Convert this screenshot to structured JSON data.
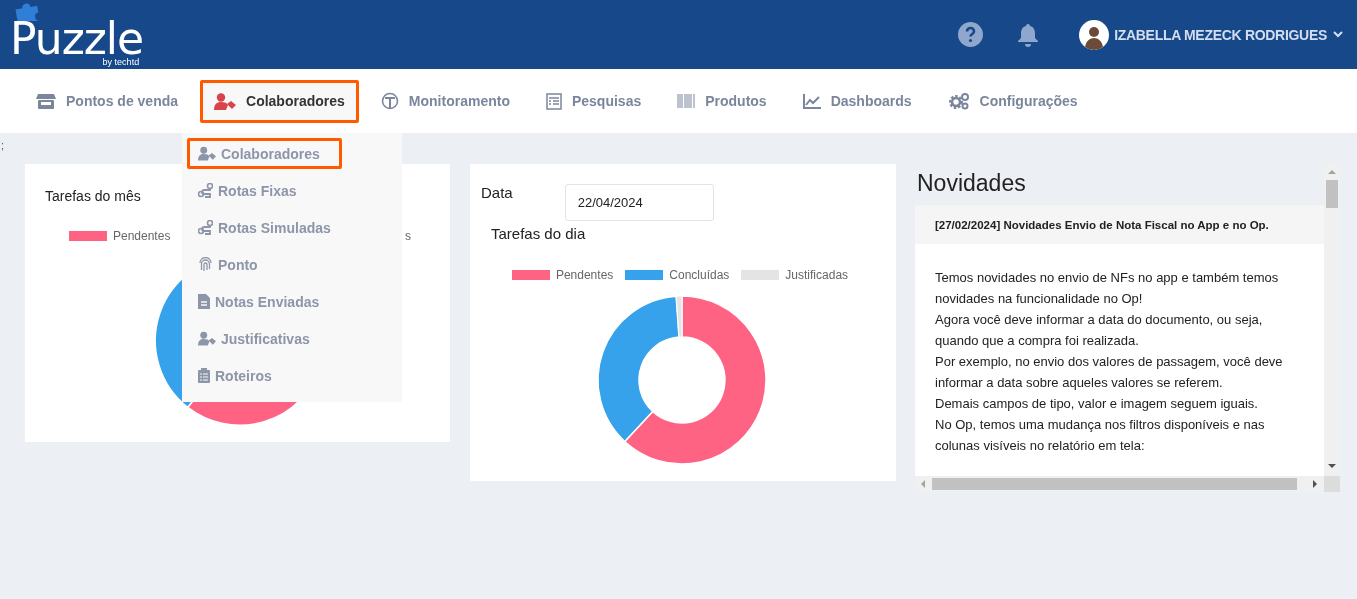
{
  "header": {
    "logo": {
      "name": "Puzzle",
      "tagline": "by techtd"
    },
    "user": {
      "name": "IZABELLA MEZECK RODRIGUES"
    }
  },
  "nav": {
    "items": [
      {
        "label": "Pontos de venda",
        "selected": false
      },
      {
        "label": "Colaboradores",
        "selected": true
      },
      {
        "label": "Monitoramento",
        "selected": false
      },
      {
        "label": "Pesquisas",
        "selected": false
      },
      {
        "label": "Produtos",
        "selected": false
      },
      {
        "label": "Dashboards",
        "selected": false
      },
      {
        "label": "Configurações",
        "selected": false
      }
    ]
  },
  "dropdown": {
    "items": [
      {
        "label": "Colaboradores",
        "selected": true
      },
      {
        "label": "Rotas Fixas",
        "selected": false
      },
      {
        "label": "Rotas Simuladas",
        "selected": false
      },
      {
        "label": "Ponto",
        "selected": false
      },
      {
        "label": "Notas Enviadas",
        "selected": false
      },
      {
        "label": "Justificativas",
        "selected": false
      },
      {
        "label": "Roteiros",
        "selected": false
      }
    ]
  },
  "stray_mark": ";",
  "month_card": {
    "title": "Tarefas do mês",
    "legend": [
      {
        "label": "Pendentes",
        "color": "#ff6384"
      },
      {
        "label": "s"
      }
    ]
  },
  "day_card": {
    "date_label": "Data",
    "date_field": {
      "value": "22/04/2024"
    },
    "title": "Tarefas do dia",
    "legend": [
      {
        "label": "Pendentes",
        "color": "#ff6384"
      },
      {
        "label": "Concluídas",
        "color": "#36a2eb"
      },
      {
        "label": "Justificadas",
        "color": "#e4e4e4"
      }
    ]
  },
  "news": {
    "title": "Novidades",
    "items": [
      {
        "heading": "[27/02/2024] Novidades Envio de Nota Fiscal no App e no Op.",
        "paragraphs": [
          "Temos novidades no envio de NFs no app e também temos novidades na funcionalidade no Op!",
          "Agora você deve informar a data do documento, ou seja, quando que a compra foi realizada.",
          "Por exemplo, no envio dos valores de passagem, você deve informar a data sobre aqueles valores se referem.",
          "Demais campos de tipo, valor e imagem seguem iguais.",
          "No Op, temos uma mudança nos filtros disponíveis e nas colunas visíveis no relatório em tela:"
        ]
      }
    ]
  }
}
